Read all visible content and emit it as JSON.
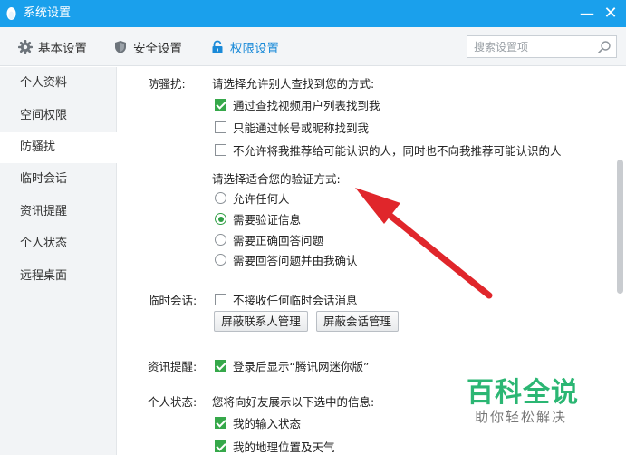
{
  "window": {
    "title": "系统设置",
    "minimize": "—",
    "close": "✕"
  },
  "toolbar": {
    "tabs": [
      {
        "label": "基本设置",
        "icon": "gear-icon"
      },
      {
        "label": "安全设置",
        "icon": "shield-icon"
      },
      {
        "label": "权限设置",
        "icon": "lock-icon",
        "active": true
      }
    ],
    "search_placeholder": "搜索设置项"
  },
  "sidebar": {
    "items": [
      {
        "label": "个人资料"
      },
      {
        "label": "空间权限"
      },
      {
        "label": "防骚扰",
        "active": true
      },
      {
        "label": "临时会话"
      },
      {
        "label": "资讯提醒"
      },
      {
        "label": "个人状态"
      },
      {
        "label": "远程桌面"
      }
    ]
  },
  "main": {
    "anti_harass": {
      "label": "防骚扰:",
      "find_prompt": "请选择允许别人查找到您的方式:",
      "find_options": [
        {
          "label": "通过查找视频用户列表找到我",
          "checked": true
        },
        {
          "label": "只能通过帐号或昵称找到我",
          "checked": false
        },
        {
          "label": "不允许将我推荐给可能认识的人，同时也不向我推荐可能认识的人",
          "checked": false
        }
      ],
      "verify_prompt": "请选择适合您的验证方式:",
      "verify_options": [
        {
          "label": "允许任何人",
          "selected": false
        },
        {
          "label": "需要验证信息",
          "selected": true
        },
        {
          "label": "需要正确回答问题",
          "selected": false
        },
        {
          "label": "需要回答问题并由我确认",
          "selected": false
        }
      ]
    },
    "temp_session": {
      "label": "临时会话:",
      "option": {
        "label": "不接收任何临时会话消息",
        "checked": false
      },
      "buttons": [
        "屏蔽联系人管理",
        "屏蔽会话管理"
      ]
    },
    "news_reminder": {
      "label": "资讯提醒:",
      "option": {
        "label": "登录后显示“腾讯网迷你版”",
        "checked": true
      }
    },
    "personal_status": {
      "label": "个人状态:",
      "prompt": "您将向好友展示以下选中的信息:",
      "options": [
        {
          "label": "我的输入状态",
          "checked": true
        },
        {
          "label": "我的地理位置及天气",
          "checked": true
        }
      ]
    }
  },
  "watermark": {
    "title": "百科全说",
    "subtitle": "助你轻松解决"
  },
  "colors": {
    "titlebar": "#1aa0ec",
    "active_tab": "#1a8ad8",
    "checkbox_checked": "#36a84a",
    "arrow": "#e0262b",
    "watermark": "#2bb673"
  }
}
